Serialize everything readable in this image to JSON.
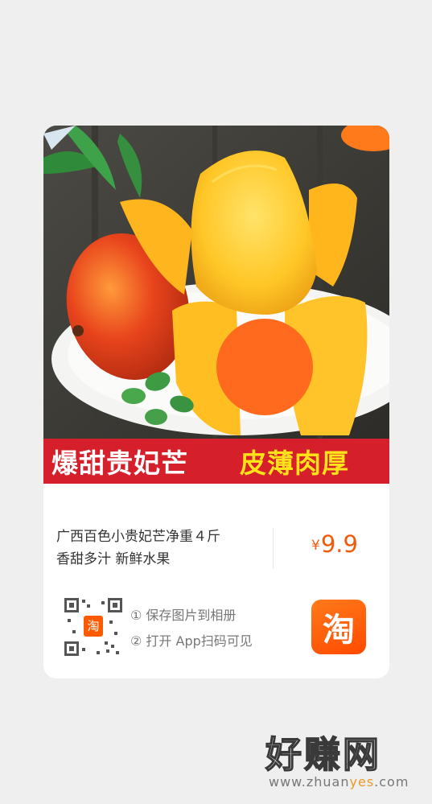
{
  "product": {
    "banner_left": "爆甜贵妃芒",
    "banner_right": "皮薄肉厚",
    "title_line1": "广西百色小贵妃芒净重４斤",
    "title_line2": "香甜多汁 新鲜水果",
    "price_currency": "¥",
    "price_value": "9.9"
  },
  "share": {
    "qr_badge": "淘",
    "step1": "① 保存图片到相册",
    "step2": "② 打开 App扫码可见",
    "app_icon": "淘"
  },
  "watermark": {
    "main": "好赚网",
    "url_prefix": "www.zhuan",
    "url_highlight": "yes",
    "url_suffix": ".com"
  },
  "colors": {
    "banner_red": "#d51f2a",
    "banner_yellow": "#ffe21a",
    "price_orange": "#ef5b0c",
    "taobao_orange": "#ff5a00"
  }
}
